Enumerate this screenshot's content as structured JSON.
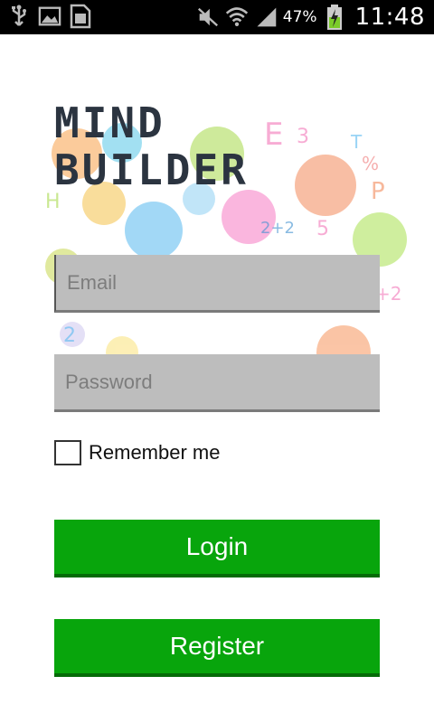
{
  "status_bar": {
    "left_icons": [
      "usb-icon",
      "image-icon",
      "sim-icon"
    ],
    "right_icons": [
      "mute-icon",
      "wifi-icon",
      "signal-icon",
      "battery-charging-icon"
    ],
    "battery": "47%",
    "time": "11:48"
  },
  "logo": {
    "line1": "Mind",
    "line2": "Builder"
  },
  "form": {
    "email_placeholder": "Email",
    "password_placeholder": "Password",
    "remember_label": "Remember me",
    "remember_checked": false
  },
  "buttons": {
    "login": "Login",
    "register": "Register"
  },
  "colors": {
    "button_green": "#08a50c",
    "field_gray": "#bdbdbd",
    "logo_dark": "#2b3440"
  },
  "collage_glyphs": [
    "E",
    "3",
    "T",
    "%",
    "P",
    "2+2",
    "2",
    "5",
    "H",
    "+2"
  ]
}
